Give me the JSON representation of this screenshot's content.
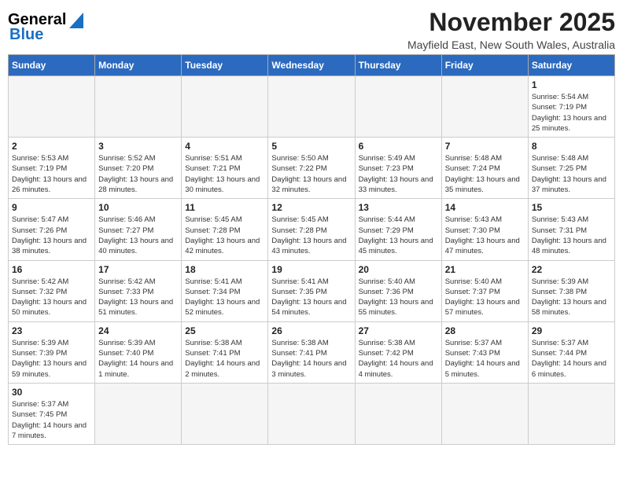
{
  "header": {
    "logo_general": "General",
    "logo_blue": "Blue",
    "month": "November 2025",
    "location": "Mayfield East, New South Wales, Australia"
  },
  "weekdays": [
    "Sunday",
    "Monday",
    "Tuesday",
    "Wednesday",
    "Thursday",
    "Friday",
    "Saturday"
  ],
  "weeks": [
    [
      {
        "day": "",
        "info": ""
      },
      {
        "day": "",
        "info": ""
      },
      {
        "day": "",
        "info": ""
      },
      {
        "day": "",
        "info": ""
      },
      {
        "day": "",
        "info": ""
      },
      {
        "day": "",
        "info": ""
      },
      {
        "day": "1",
        "info": "Sunrise: 5:54 AM\nSunset: 7:19 PM\nDaylight: 13 hours and 25 minutes."
      }
    ],
    [
      {
        "day": "2",
        "info": "Sunrise: 5:53 AM\nSunset: 7:19 PM\nDaylight: 13 hours and 26 minutes."
      },
      {
        "day": "3",
        "info": "Sunrise: 5:52 AM\nSunset: 7:20 PM\nDaylight: 13 hours and 28 minutes."
      },
      {
        "day": "4",
        "info": "Sunrise: 5:51 AM\nSunset: 7:21 PM\nDaylight: 13 hours and 30 minutes."
      },
      {
        "day": "5",
        "info": "Sunrise: 5:50 AM\nSunset: 7:22 PM\nDaylight: 13 hours and 32 minutes."
      },
      {
        "day": "6",
        "info": "Sunrise: 5:49 AM\nSunset: 7:23 PM\nDaylight: 13 hours and 33 minutes."
      },
      {
        "day": "7",
        "info": "Sunrise: 5:48 AM\nSunset: 7:24 PM\nDaylight: 13 hours and 35 minutes."
      },
      {
        "day": "8",
        "info": "Sunrise: 5:48 AM\nSunset: 7:25 PM\nDaylight: 13 hours and 37 minutes."
      }
    ],
    [
      {
        "day": "9",
        "info": "Sunrise: 5:47 AM\nSunset: 7:26 PM\nDaylight: 13 hours and 38 minutes."
      },
      {
        "day": "10",
        "info": "Sunrise: 5:46 AM\nSunset: 7:27 PM\nDaylight: 13 hours and 40 minutes."
      },
      {
        "day": "11",
        "info": "Sunrise: 5:45 AM\nSunset: 7:28 PM\nDaylight: 13 hours and 42 minutes."
      },
      {
        "day": "12",
        "info": "Sunrise: 5:45 AM\nSunset: 7:28 PM\nDaylight: 13 hours and 43 minutes."
      },
      {
        "day": "13",
        "info": "Sunrise: 5:44 AM\nSunset: 7:29 PM\nDaylight: 13 hours and 45 minutes."
      },
      {
        "day": "14",
        "info": "Sunrise: 5:43 AM\nSunset: 7:30 PM\nDaylight: 13 hours and 47 minutes."
      },
      {
        "day": "15",
        "info": "Sunrise: 5:43 AM\nSunset: 7:31 PM\nDaylight: 13 hours and 48 minutes."
      }
    ],
    [
      {
        "day": "16",
        "info": "Sunrise: 5:42 AM\nSunset: 7:32 PM\nDaylight: 13 hours and 50 minutes."
      },
      {
        "day": "17",
        "info": "Sunrise: 5:42 AM\nSunset: 7:33 PM\nDaylight: 13 hours and 51 minutes."
      },
      {
        "day": "18",
        "info": "Sunrise: 5:41 AM\nSunset: 7:34 PM\nDaylight: 13 hours and 52 minutes."
      },
      {
        "day": "19",
        "info": "Sunrise: 5:41 AM\nSunset: 7:35 PM\nDaylight: 13 hours and 54 minutes."
      },
      {
        "day": "20",
        "info": "Sunrise: 5:40 AM\nSunset: 7:36 PM\nDaylight: 13 hours and 55 minutes."
      },
      {
        "day": "21",
        "info": "Sunrise: 5:40 AM\nSunset: 7:37 PM\nDaylight: 13 hours and 57 minutes."
      },
      {
        "day": "22",
        "info": "Sunrise: 5:39 AM\nSunset: 7:38 PM\nDaylight: 13 hours and 58 minutes."
      }
    ],
    [
      {
        "day": "23",
        "info": "Sunrise: 5:39 AM\nSunset: 7:39 PM\nDaylight: 13 hours and 59 minutes."
      },
      {
        "day": "24",
        "info": "Sunrise: 5:39 AM\nSunset: 7:40 PM\nDaylight: 14 hours and 1 minute."
      },
      {
        "day": "25",
        "info": "Sunrise: 5:38 AM\nSunset: 7:41 PM\nDaylight: 14 hours and 2 minutes."
      },
      {
        "day": "26",
        "info": "Sunrise: 5:38 AM\nSunset: 7:41 PM\nDaylight: 14 hours and 3 minutes."
      },
      {
        "day": "27",
        "info": "Sunrise: 5:38 AM\nSunset: 7:42 PM\nDaylight: 14 hours and 4 minutes."
      },
      {
        "day": "28",
        "info": "Sunrise: 5:37 AM\nSunset: 7:43 PM\nDaylight: 14 hours and 5 minutes."
      },
      {
        "day": "29",
        "info": "Sunrise: 5:37 AM\nSunset: 7:44 PM\nDaylight: 14 hours and 6 minutes."
      }
    ],
    [
      {
        "day": "30",
        "info": "Sunrise: 5:37 AM\nSunset: 7:45 PM\nDaylight: 14 hours and 7 minutes."
      },
      {
        "day": "",
        "info": ""
      },
      {
        "day": "",
        "info": ""
      },
      {
        "day": "",
        "info": ""
      },
      {
        "day": "",
        "info": ""
      },
      {
        "day": "",
        "info": ""
      },
      {
        "day": "",
        "info": ""
      }
    ]
  ]
}
